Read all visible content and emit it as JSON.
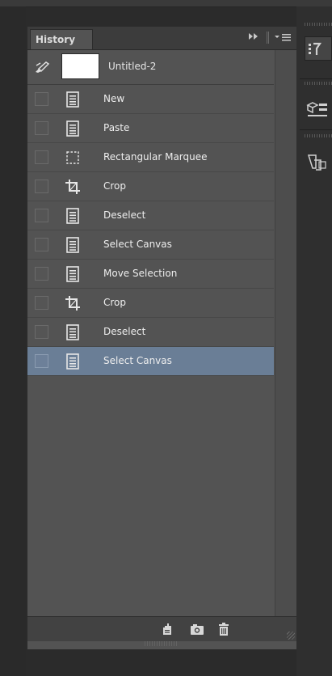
{
  "panel": {
    "tab_label": "History",
    "header_buttons": [
      "collapse-panels-icon",
      "panel-menu-icon"
    ],
    "snapshot": {
      "label": "Untitled-2",
      "icon": "history-brush-icon"
    },
    "states": [
      {
        "label": "New",
        "icon": "document-icon",
        "selected": false
      },
      {
        "label": "Paste",
        "icon": "document-icon",
        "selected": false
      },
      {
        "label": "Rectangular Marquee",
        "icon": "marquee-icon",
        "selected": false
      },
      {
        "label": "Crop",
        "icon": "crop-icon",
        "selected": false
      },
      {
        "label": "Deselect",
        "icon": "document-icon",
        "selected": false
      },
      {
        "label": "Select Canvas",
        "icon": "document-icon",
        "selected": false
      },
      {
        "label": "Move Selection",
        "icon": "document-icon",
        "selected": false
      },
      {
        "label": "Crop",
        "icon": "crop-icon",
        "selected": false
      },
      {
        "label": "Deselect",
        "icon": "document-icon",
        "selected": false
      },
      {
        "label": "Select Canvas",
        "icon": "document-icon",
        "selected": true
      }
    ],
    "footer_buttons": [
      "new-document-from-state-icon",
      "new-snapshot-icon",
      "delete-state-icon"
    ],
    "colors": {
      "panel_bg": "#535353",
      "selected_row": "#6a7e96",
      "header_bg": "#3c3c3c"
    }
  },
  "dock": {
    "buttons": [
      "properties-icon",
      "layers-3d-icon",
      "paths-icon"
    ]
  }
}
